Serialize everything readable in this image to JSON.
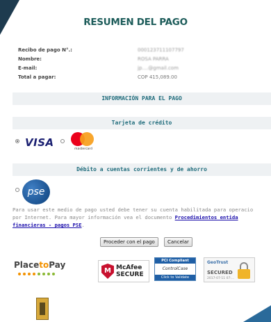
{
  "title": "RESUMEN DEL PAGO",
  "summary": {
    "receipt_label": "Recibo de pago N°.:",
    "receipt_value": "000123711107797",
    "name_label": "Nombre:",
    "name_value": "ROSA PARRA",
    "email_label": "E-mail:",
    "email_value": "jp....@gmail.com",
    "total_label": "Total a pagar:",
    "total_value": "COP 415,089.00"
  },
  "sections": {
    "payment_info": "INFORMACIÓN PARA EL PAGO",
    "credit_card": "Tarjeta de crédito",
    "debit": "Débito a cuentas corrientes y de ahorro"
  },
  "methods": {
    "visa": "VISA",
    "mastercard": "mastercard",
    "pse": "pse",
    "visa_selected": true
  },
  "pse_info": {
    "line1": "Para usar este medio de pago usted debe tener su cuenta habilitada para operacio",
    "line2_prefix": "por Internet. Para mayor información vea el documento ",
    "link_part1": "Procedimientos entida",
    "link_part2": "financieras - pagos PSE",
    "line3_suffix": "."
  },
  "buttons": {
    "proceed": "Proceder con el pago",
    "cancel": "Cancelar"
  },
  "logos": {
    "placetopay_a": "Place",
    "placetopay_b": "to",
    "placetopay_c": "Pay",
    "mcafee_a": "McAfee",
    "mcafee_b": "SECURE",
    "pci_top": "PCI Compliant",
    "pci_mid": "ControlCase",
    "pci_bot": "Click to Validate",
    "geotrust": "GeoTrust",
    "geotrust_secured": "SECURED",
    "geotrust_date": "2017-07-11 07:..."
  },
  "colors": {
    "title": "#1d5c5a",
    "band_text": "#1e6b7b",
    "visa": "#1a1f71",
    "link": "#1a0dab"
  }
}
